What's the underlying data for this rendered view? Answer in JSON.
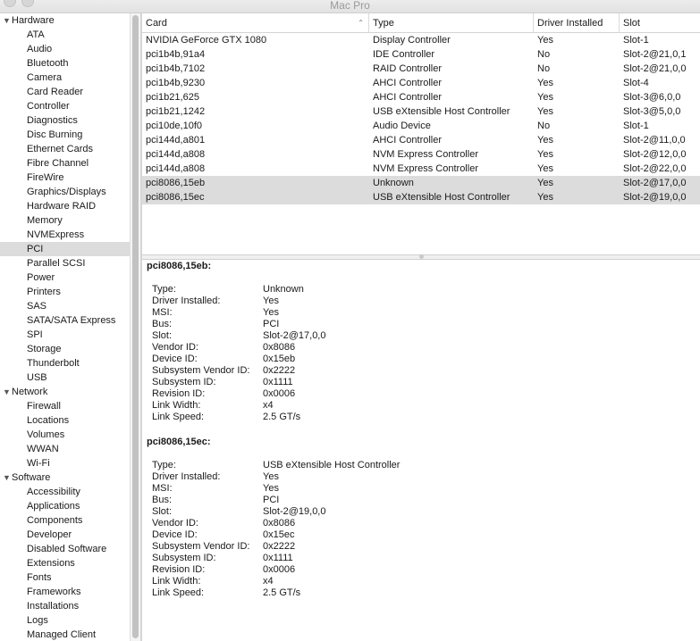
{
  "window": {
    "title": "Mac Pro"
  },
  "sidebar": {
    "groups": [
      {
        "label": "Hardware",
        "items": [
          "ATA",
          "Audio",
          "Bluetooth",
          "Camera",
          "Card Reader",
          "Controller",
          "Diagnostics",
          "Disc Burning",
          "Ethernet Cards",
          "Fibre Channel",
          "FireWire",
          "Graphics/Displays",
          "Hardware RAID",
          "Memory",
          "NVMExpress",
          "PCI",
          "Parallel SCSI",
          "Power",
          "Printers",
          "SAS",
          "SATA/SATA Express",
          "SPI",
          "Storage",
          "Thunderbolt",
          "USB"
        ]
      },
      {
        "label": "Network",
        "items": [
          "Firewall",
          "Locations",
          "Volumes",
          "WWAN",
          "Wi-Fi"
        ]
      },
      {
        "label": "Software",
        "items": [
          "Accessibility",
          "Applications",
          "Components",
          "Developer",
          "Disabled Software",
          "Extensions",
          "Fonts",
          "Frameworks",
          "Installations",
          "Logs",
          "Managed Client"
        ]
      }
    ],
    "selected_item": "PCI"
  },
  "table": {
    "headers": [
      "Card",
      "Type",
      "Driver Installed",
      "Slot"
    ],
    "rows": [
      [
        "NVIDIA GeForce GTX 1080",
        "Display Controller",
        "Yes",
        "Slot-1"
      ],
      [
        "pci1b4b,91a4",
        "IDE Controller",
        "No",
        "Slot-2@21,0,1"
      ],
      [
        "pci1b4b,7102",
        "RAID Controller",
        "No",
        "Slot-2@21,0,0"
      ],
      [
        "pci1b4b,9230",
        "AHCI Controller",
        "Yes",
        "Slot-4"
      ],
      [
        "pci1b21,625",
        "AHCI Controller",
        "Yes",
        "Slot-3@6,0,0"
      ],
      [
        "pci1b21,1242",
        "USB eXtensible Host Controller",
        "Yes",
        "Slot-3@5,0,0"
      ],
      [
        "pci10de,10f0",
        "Audio Device",
        "No",
        "Slot-1"
      ],
      [
        "pci144d,a801",
        "AHCI Controller",
        "Yes",
        "Slot-2@11,0,0"
      ],
      [
        "pci144d,a808",
        "NVM Express Controller",
        "Yes",
        "Slot-2@12,0,0"
      ],
      [
        "pci144d,a808",
        "NVM Express Controller",
        "Yes",
        "Slot-2@22,0,0"
      ],
      [
        "pci8086,15eb",
        "Unknown",
        "Yes",
        "Slot-2@17,0,0"
      ],
      [
        "pci8086,15ec",
        "USB eXtensible Host Controller",
        "Yes",
        "Slot-2@19,0,0"
      ]
    ],
    "selected_rows": [
      10,
      11
    ]
  },
  "details": [
    {
      "title": "pci8086,15eb:",
      "fields": [
        [
          "Type:",
          "Unknown"
        ],
        [
          "Driver Installed:",
          "Yes"
        ],
        [
          "MSI:",
          "Yes"
        ],
        [
          "Bus:",
          "PCI"
        ],
        [
          "Slot:",
          "Slot-2@17,0,0"
        ],
        [
          "Vendor ID:",
          "0x8086"
        ],
        [
          "Device ID:",
          "0x15eb"
        ],
        [
          "Subsystem Vendor ID:",
          "0x2222"
        ],
        [
          "Subsystem ID:",
          "0x1111"
        ],
        [
          "Revision ID:",
          "0x0006"
        ],
        [
          "Link Width:",
          "x4"
        ],
        [
          "Link Speed:",
          "2.5 GT/s"
        ]
      ]
    },
    {
      "title": "pci8086,15ec:",
      "fields": [
        [
          "Type:",
          "USB eXtensible Host Controller"
        ],
        [
          "Driver Installed:",
          "Yes"
        ],
        [
          "MSI:",
          "Yes"
        ],
        [
          "Bus:",
          "PCI"
        ],
        [
          "Slot:",
          "Slot-2@19,0,0"
        ],
        [
          "Vendor ID:",
          "0x8086"
        ],
        [
          "Device ID:",
          "0x15ec"
        ],
        [
          "Subsystem Vendor ID:",
          "0x2222"
        ],
        [
          "Subsystem ID:",
          "0x1111"
        ],
        [
          "Revision ID:",
          "0x0006"
        ],
        [
          "Link Width:",
          "x4"
        ],
        [
          "Link Speed:",
          "2.5 GT/s"
        ]
      ]
    }
  ],
  "colors": {
    "selection": "#dcdcdc",
    "grid_line": "#d4d4d4"
  },
  "icons": {
    "group_expanded": "disclosure-triangle-down-icon",
    "sort": "sort-ascending-icon"
  }
}
